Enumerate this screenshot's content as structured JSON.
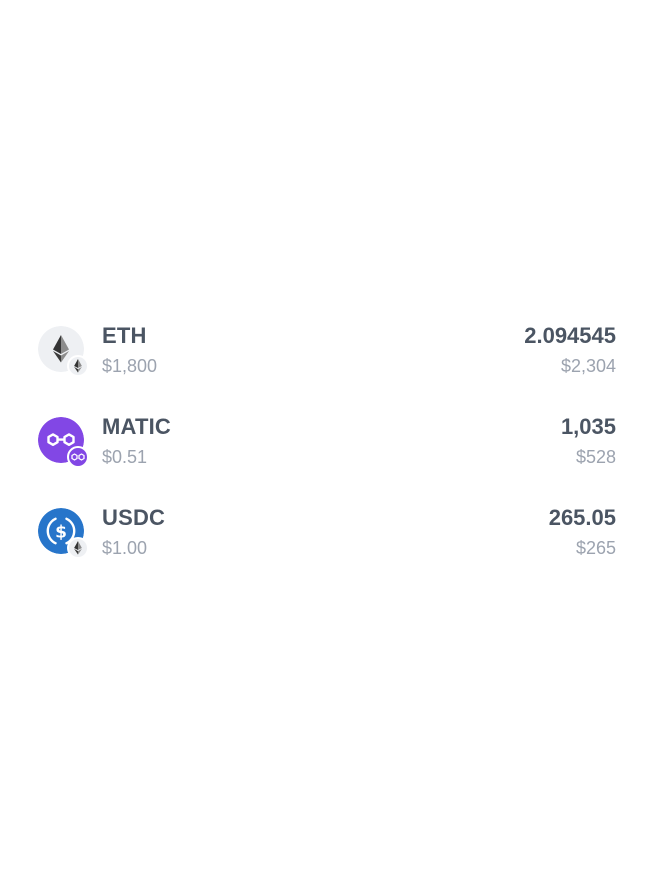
{
  "tokens": [
    {
      "symbol": "ETH",
      "price": "$1,800",
      "balance": "2.094545",
      "value": "$2,304",
      "icon": "ethereum-icon",
      "network_icon": "ethereum-network-icon"
    },
    {
      "symbol": "MATIC",
      "price": "$0.51",
      "balance": "1,035",
      "value": "$528",
      "icon": "polygon-icon",
      "network_icon": "polygon-network-icon"
    },
    {
      "symbol": "USDC",
      "price": "$1.00",
      "balance": "265.05",
      "value": "$265",
      "icon": "usdc-icon",
      "network_icon": "ethereum-network-icon"
    }
  ],
  "colors": {
    "primary_text": "#4b5563",
    "secondary_text": "#9ca3af",
    "eth_bg": "#eef0f3",
    "matic": "#8247e5",
    "usdc": "#2775ca"
  }
}
